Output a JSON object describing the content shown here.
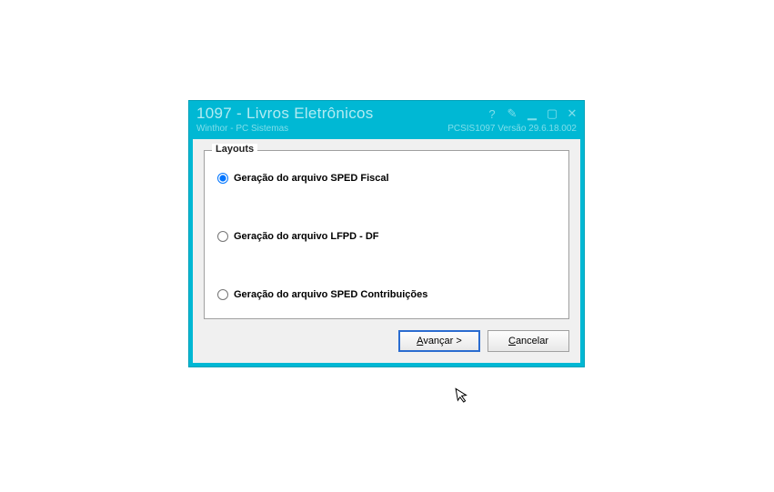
{
  "window": {
    "title": "1097 - Livros Eletrônicos",
    "subtitle_left": "Winthor - PC Sistemas",
    "subtitle_right": "PCSIS1097   Versão  29.6.18.002"
  },
  "groupbox": {
    "legend": "Layouts",
    "options": [
      {
        "label": "Geração do arquivo SPED Fiscal",
        "checked": true
      },
      {
        "label": "Geração do arquivo LFPD - DF",
        "checked": false
      },
      {
        "label": "Geração do arquivo SPED Contribuições",
        "checked": false
      }
    ]
  },
  "buttons": {
    "advance_prefix": "A",
    "advance_rest": "vançar >",
    "cancel_prefix": "C",
    "cancel_rest": "ancelar"
  },
  "titlebar_icons": {
    "help": "?",
    "edit": "✎",
    "minimize": "▁",
    "maximize": "▢",
    "close": "✕"
  }
}
